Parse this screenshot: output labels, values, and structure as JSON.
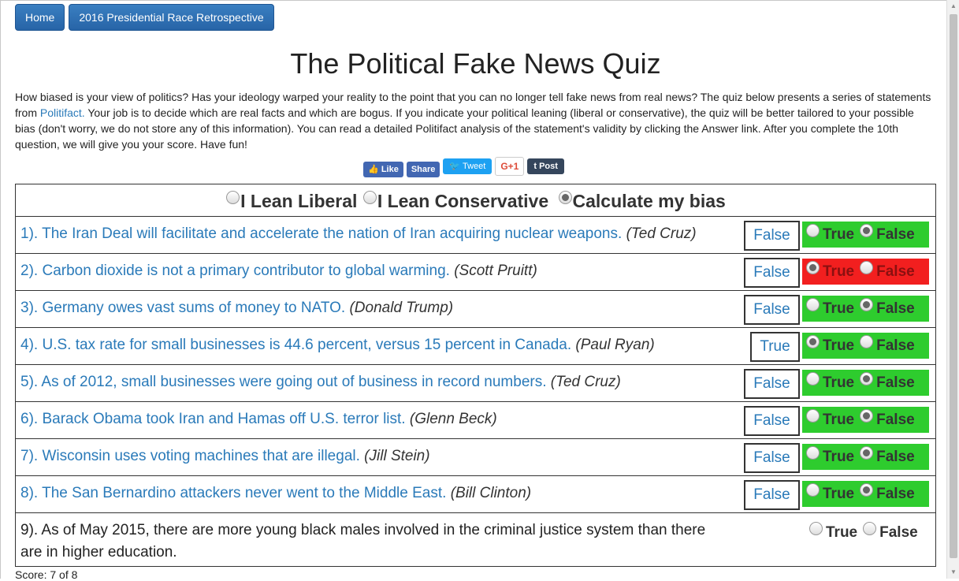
{
  "nav": {
    "home": "Home",
    "retro": "2016 Presidential Race Retrospective"
  },
  "title": "The Political Fake News Quiz",
  "intro": {
    "before_link": "How biased is your view of politics? Has your ideology warped your reality to the point that you can no longer tell fake news from real news? The quiz below presents a series of statements from ",
    "link": "Politifact.",
    "after_link": " Your job is to decide which are real facts and which are bogus. If you indicate your political leaning (liberal or conservative), the quiz will be better tailored to your possible bias (don't worry, we do not store any of this information). You can read a detailed Politifact analysis of the statement's validity by clicking the Answer link. After you complete the 10th question, we will give you your score. Have fun!"
  },
  "social": {
    "like": "Like",
    "share": "Share",
    "tweet": "Tweet",
    "gplus": "G+1",
    "post": "Post"
  },
  "bias": {
    "liberal": "I Lean Liberal",
    "conservative": "I Lean Conservative",
    "calculate": "Calculate my bias",
    "selected": "calculate"
  },
  "choice_labels": {
    "true": "True",
    "false": "False"
  },
  "questions": [
    {
      "num": "1).",
      "text": "The Iran Deal will facilitate and accelerate the nation of Iran acquiring nuclear weapons.",
      "who": "(Ted Cruz)",
      "answer": "False",
      "result": "correct",
      "selected": "false"
    },
    {
      "num": "2).",
      "text": "Carbon dioxide is not a primary contributor to global warming.",
      "who": "(Scott Pruitt)",
      "answer": "False",
      "result": "incorrect",
      "selected": "true"
    },
    {
      "num": "3).",
      "text": "Germany owes vast sums of money to NATO.",
      "who": "(Donald Trump)",
      "answer": "False",
      "result": "correct",
      "selected": "false"
    },
    {
      "num": "4).",
      "text": "U.S. tax rate for small businesses is 44.6 percent, versus 15 percent in Canada.",
      "who": "(Paul Ryan)",
      "answer": "True",
      "result": "correct",
      "selected": "true"
    },
    {
      "num": "5).",
      "text": "As of 2012, small businesses were going out of business in record numbers.",
      "who": "(Ted Cruz)",
      "answer": "False",
      "result": "correct",
      "selected": "false"
    },
    {
      "num": "6).",
      "text": "Barack Obama took Iran and Hamas off U.S. terror list.",
      "who": "(Glenn Beck)",
      "answer": "False",
      "result": "correct",
      "selected": "false"
    },
    {
      "num": "7).",
      "text": "Wisconsin uses voting machines that are illegal.",
      "who": "(Jill Stein)",
      "answer": "False",
      "result": "correct",
      "selected": "false"
    },
    {
      "num": "8).",
      "text": "The San Bernardino attackers never went to the Middle East.",
      "who": "(Bill Clinton)",
      "answer": "False",
      "result": "correct",
      "selected": "false"
    },
    {
      "num": "9).",
      "text": "As of May 2015, there are more young black males involved in the criminal justice system than there are in higher education.",
      "who": "",
      "answer": "",
      "result": "unanswered",
      "selected": ""
    }
  ],
  "score": "Score: 7 of 8",
  "colors": {
    "correct": "#2ecc2e",
    "incorrect": "#f21f1f",
    "link": "#2a7ab9",
    "nav": "#2764a7"
  }
}
